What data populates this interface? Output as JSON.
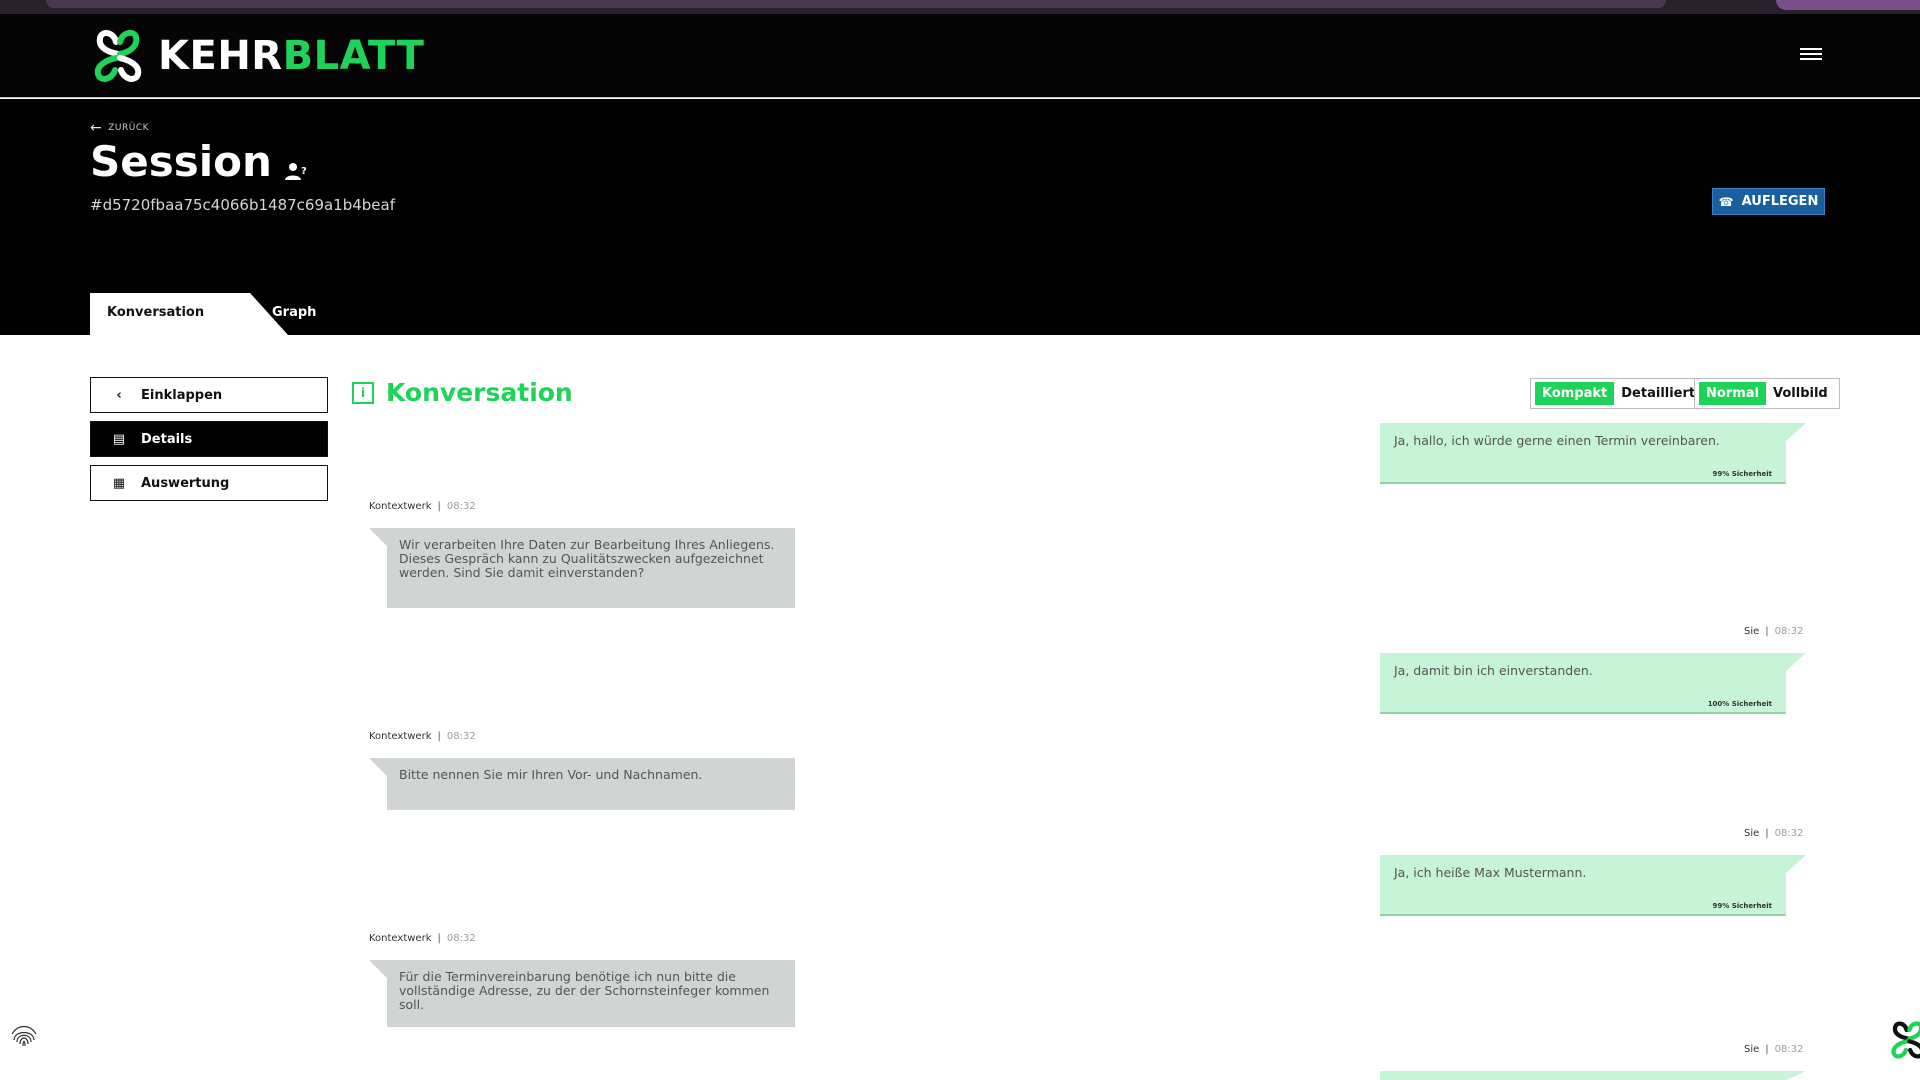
{
  "brand": {
    "name_white": "KEHR",
    "name_green": "BLATT"
  },
  "header": {
    "back_label": "ZURÜCK",
    "title": "Session",
    "session_id": "#d5720fbaa75c4066b1487c69a1b4beaf",
    "hangup_label": "AUFLEGEN"
  },
  "tabs": [
    {
      "label": "Konversation"
    },
    {
      "label": "Graph"
    }
  ],
  "sidebar": {
    "items": [
      {
        "label": "Einklappen",
        "icon": "chevron-left-icon"
      },
      {
        "label": "Details",
        "icon": "details-icon"
      },
      {
        "label": "Auswertung",
        "icon": "chart-icon"
      }
    ]
  },
  "conversation": {
    "heading": "Konversation",
    "view_toggle": {
      "compact": "Kompakt",
      "detailed": "Detailliert"
    },
    "size_toggle": {
      "normal": "Normal",
      "full": "Vollbild"
    }
  },
  "messages": [
    {
      "from": "user",
      "text": "Ja, hallo, ich würde gerne einen Termin vereinbaren.",
      "confidence": "99% Sicherheit"
    },
    {
      "from": "bot",
      "sender": "Kontextwerk",
      "time": "08:32",
      "text": "Wir verarbeiten Ihre Daten zur Bearbeitung Ihres Anliegens. Dieses Gespräch kann zu Qualitätszwecken aufgezeichnet werden. Sind Sie damit einverstanden?"
    },
    {
      "from": "user",
      "sender": "Sie",
      "time": "08:32",
      "text": "Ja, damit bin ich einverstanden.",
      "confidence": "100% Sicherheit"
    },
    {
      "from": "bot",
      "sender": "Kontextwerk",
      "time": "08:32",
      "text": "Bitte nennen Sie mir Ihren Vor- und Nachnamen."
    },
    {
      "from": "user",
      "sender": "Sie",
      "time": "08:32",
      "text": "Ja, ich heiße Max Mustermann.",
      "confidence": "99% Sicherheit"
    },
    {
      "from": "bot",
      "sender": "Kontextwerk",
      "time": "08:32",
      "text": "Für die Terminvereinbarung benötige ich nun bitte die vollständige Adresse, zu der der Schornsteinfeger kommen soll."
    },
    {
      "from": "user",
      "sender": "Sie",
      "time": "08:32"
    }
  ],
  "colors": {
    "accent": "#1fd25a",
    "user_bubble": "#c7f3d6",
    "bot_bubble": "#d0d5d4",
    "hangup": "#1a5f9e"
  }
}
